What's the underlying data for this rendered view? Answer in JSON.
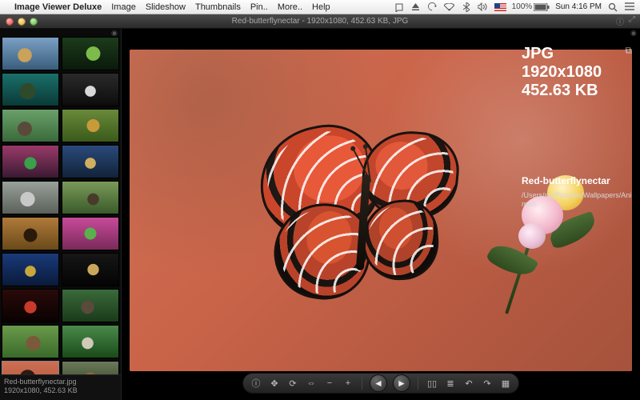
{
  "menubar": {
    "apple": "",
    "app_name": "Image Viewer Deluxe",
    "items": [
      "Image",
      "Slideshow",
      "Thumbnails",
      "Pin..",
      "More..",
      "Help"
    ],
    "battery": "100%",
    "clock": "Sun 4:16 PM"
  },
  "window": {
    "title": "Red-butterflynectar - 1920x1080, 452.63 KB, JPG"
  },
  "info": {
    "format": "JPG",
    "dimensions": "1920x1080",
    "size": "452.63 KB",
    "filename": "Red-butterflynectar",
    "path": "/Users/sw/Pictures/Wallpapers/Animals"
  },
  "footer": {
    "filename": "Red-butterflynectar.jpg",
    "meta": "1920x1080, 452.63 KB"
  },
  "thumbs": [
    {
      "bg": "linear-gradient(#7aa0c4,#3a5d7c)",
      "accent": "radial-gradient(circle at 40% 55%,#caa25a 0 18%,transparent 19%)"
    },
    {
      "bg": "linear-gradient(#1c3b1c,#0a1a0a)",
      "accent": "radial-gradient(circle at 55% 50%,#7dbb4a 0 20%,transparent 21%)"
    },
    {
      "bg": "linear-gradient(#1a6f6a,#0a3a37)",
      "accent": "radial-gradient(circle at 45% 55%,#2f4a2a 0 22%,transparent 23%)"
    },
    {
      "bg": "linear-gradient(#2a2a2a,#0c0c0c)",
      "accent": "radial-gradient(circle at 50% 55%,#d8d8d8 0 16%,transparent 17%)"
    },
    {
      "bg": "linear-gradient(#6aa06a,#3a6a3a)",
      "accent": "radial-gradient(circle at 40% 60%,#5a4a3a 0 18%,transparent 19%)"
    },
    {
      "bg": "linear-gradient(#6a8a3a,#3a5a1a)",
      "accent": "radial-gradient(circle at 55% 50%,#c89a3a 0 18%,transparent 19%)"
    },
    {
      "bg": "linear-gradient(#9a3a6a,#3a1a32)",
      "accent": "radial-gradient(circle at 50% 55%,#3aa04a 0 18%,transparent 19%)"
    },
    {
      "bg": "linear-gradient(#2a4a7a,#12233a)",
      "accent": "radial-gradient(circle at 50% 55%,#d0b060 0 16%,transparent 17%)"
    },
    {
      "bg": "linear-gradient(#9aa09a,#5a605a)",
      "accent": "radial-gradient(circle at 45% 55%,#c8c8c8 0 20%,transparent 21%)"
    },
    {
      "bg": "linear-gradient(#7a9a5a,#3a5a2a)",
      "accent": "radial-gradient(circle at 55% 55%,#4a3a2a 0 16%,transparent 17%)"
    },
    {
      "bg": "linear-gradient(#b07a3a,#6a4a1a)",
      "accent": "radial-gradient(circle at 50% 55%,#2a1a0a 0 20%,transparent 21%)"
    },
    {
      "bg": "linear-gradient(#c84a9a,#7a2a5a)",
      "accent": "radial-gradient(circle at 50% 50%,#5ab04a 0 18%,transparent 19%)"
    },
    {
      "bg": "linear-gradient(#1a3a7a,#0a1a3a)",
      "accent": "radial-gradient(circle at 50% 55%,#c8a83a 0 16%,transparent 17%)"
    },
    {
      "bg": "linear-gradient(#161616,#040404)",
      "accent": "radial-gradient(circle at 55% 50%,#caa85a 0 16%,transparent 17%)"
    },
    {
      "bg": "linear-gradient(#2a0a0a,#0a0202)",
      "accent": "radial-gradient(circle at 50% 55%,#c83a2a 0 18%,transparent 19%)"
    },
    {
      "bg": "linear-gradient(#3a6a3a,#1a3a1a)",
      "accent": "radial-gradient(circle at 45% 55%,#5a4a3a 0 18%,transparent 19%)"
    },
    {
      "bg": "linear-gradient(#6a9a4a,#3a6a2a)",
      "accent": "radial-gradient(circle at 55% 55%,#7a5a3a 0 20%,transparent 21%)"
    },
    {
      "bg": "linear-gradient(#4a8a4a,#1a4a1a)",
      "accent": "radial-gradient(circle at 45% 55%,#d0c8b8 0 16%,transparent 17%)"
    },
    {
      "bg": "linear-gradient(#cf6f53,#a5523c)",
      "accent": "radial-gradient(circle at 45% 50%,#2a1a12 0 22%,transparent 23%)",
      "selected": true
    },
    {
      "bg": "linear-gradient(#6a7a5a,#2a3a1a)",
      "accent": "radial-gradient(circle at 50% 55%,#8a6a3a 0 20%,transparent 21%)"
    }
  ],
  "toolbar": {
    "items": [
      {
        "name": "info-icon",
        "glyph": "ⓘ"
      },
      {
        "name": "move-icon",
        "glyph": "✥"
      },
      {
        "name": "refresh-icon",
        "glyph": "⟳"
      },
      {
        "name": "fit-icon",
        "glyph": "⇔"
      },
      {
        "name": "zoom-out-icon",
        "glyph": "−"
      },
      {
        "name": "zoom-in-icon",
        "glyph": "+"
      },
      {
        "sep": true
      },
      {
        "name": "prev-button",
        "glyph": "◄",
        "nav": true
      },
      {
        "name": "next-button",
        "glyph": "►",
        "nav": true
      },
      {
        "sep": true
      },
      {
        "name": "actual-size-icon",
        "glyph": "▯▯"
      },
      {
        "name": "list-icon",
        "glyph": "≣"
      },
      {
        "name": "rotate-ccw-icon",
        "glyph": "↶"
      },
      {
        "name": "rotate-cw-icon",
        "glyph": "↷"
      },
      {
        "name": "thumbnails-icon",
        "glyph": "▦"
      }
    ]
  }
}
